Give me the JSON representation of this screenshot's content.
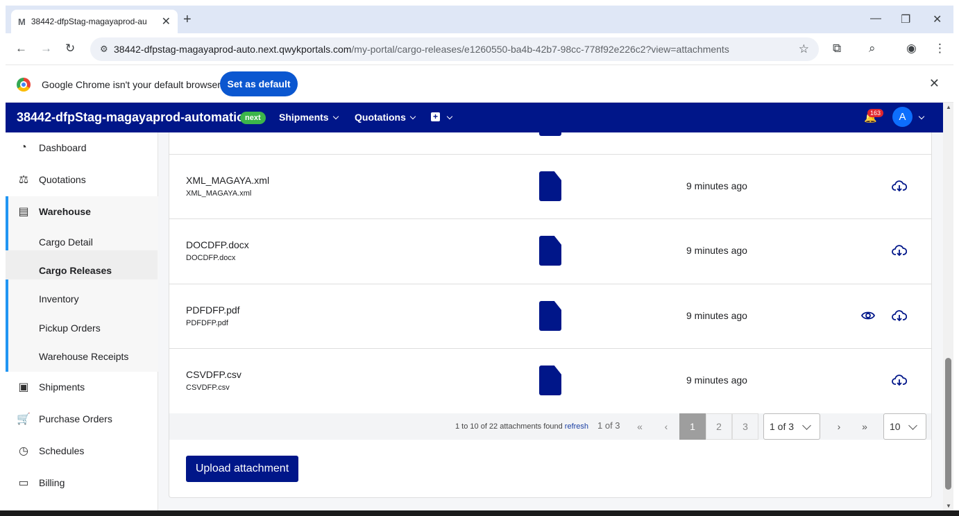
{
  "browser": {
    "tab_title": "38442-dfpStag-magayaprod-au",
    "tab_favicon": "M",
    "url_host": "38442-dfpstag-magayaprod-auto.next.qwykportals.com",
    "url_path": "/my-portal/cargo-releases/e1260550-ba4b-42b7-98cc-778f92e226c2?view=attachments",
    "infobar_text": "Google Chrome isn't your default browser",
    "set_default_label": "Set as default"
  },
  "header": {
    "brand": "38442-dfpStag-magayaprod-automation",
    "badge": "next",
    "nav": [
      "Shipments",
      "Quotations"
    ],
    "notification_count": "163",
    "avatar_initial": "A",
    "brand_color": "#001689"
  },
  "sidebar": {
    "items": [
      {
        "label": "Dashboard",
        "icon": "dashboard-icon"
      },
      {
        "label": "Quotations",
        "icon": "quotations-icon"
      },
      {
        "label": "Warehouse",
        "icon": "warehouse-icon"
      },
      {
        "label": "Shipments",
        "icon": "shipments-icon"
      },
      {
        "label": "Purchase Orders",
        "icon": "cart-icon"
      },
      {
        "label": "Schedules",
        "icon": "clock-icon"
      },
      {
        "label": "Billing",
        "icon": "billing-icon"
      }
    ],
    "warehouse_sub": [
      "Cargo Detail",
      "Cargo Releases",
      "Inventory",
      "Pickup Orders",
      "Warehouse Receipts"
    ],
    "active_sub": "Cargo Releases"
  },
  "attachments": {
    "rows": [
      {
        "name": "XML_MAGAYA.xml",
        "sub": "XML_MAGAYA.xml",
        "time": "9 minutes ago",
        "preview": false
      },
      {
        "name": "DOCDFP.docx",
        "sub": "DOCDFP.docx",
        "time": "9 minutes ago",
        "preview": false
      },
      {
        "name": "PDFDFP.pdf",
        "sub": "PDFDFP.pdf",
        "time": "9 minutes ago",
        "preview": true
      },
      {
        "name": "CSVDFP.csv",
        "sub": "CSVDFP.csv",
        "time": "9 minutes ago",
        "preview": false
      }
    ],
    "pager": {
      "info": "1 to 10 of 22 attachments found",
      "refresh": "refresh",
      "of_text": "1 of 3",
      "pages": [
        "1",
        "2",
        "3"
      ],
      "current_page": "1",
      "page_select": "1 of 3",
      "page_size": "10"
    },
    "upload_label": "Upload attachment"
  }
}
